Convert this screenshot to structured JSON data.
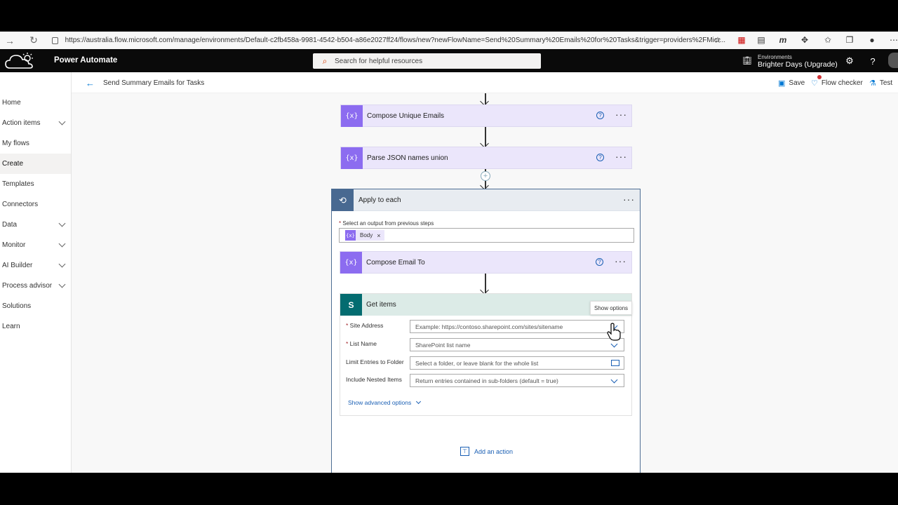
{
  "browser": {
    "url": "https://australia.flow.microsoft.com/manage/environments/Default-c2fb458a-9981-4542-b504-a86e2027ff24/flows/new?newFlowName=Send%20Summary%20Emails%20for%20Tasks&trigger=providers%2FMicr..."
  },
  "app": {
    "name": "Power Automate",
    "search_placeholder": "Search for helpful resources",
    "environment_label": "Environments",
    "environment_name": "Brighter Days (Upgrade)"
  },
  "nav": {
    "items": [
      {
        "label": "Home"
      },
      {
        "label": "Action items"
      },
      {
        "label": "My flows"
      },
      {
        "label": "Create"
      },
      {
        "label": "Templates"
      },
      {
        "label": "Connectors"
      },
      {
        "label": "Data"
      },
      {
        "label": "Monitor"
      },
      {
        "label": "AI Builder"
      },
      {
        "label": "Process advisor"
      },
      {
        "label": "Solutions"
      },
      {
        "label": "Learn"
      }
    ]
  },
  "toolbar": {
    "flow_title": "Send Summary Emails for Tasks",
    "save": "Save",
    "flow_checker": "Flow checker",
    "test": "Test"
  },
  "flow": {
    "compose_unique": "Compose Unique Emails",
    "parse_json": "Parse JSON names union",
    "apply_each": "Apply to each",
    "select_output_label": "Select an output from previous steps",
    "token_body": "Body",
    "compose_email_to": "Compose Email To",
    "get_items": "Get items",
    "show_options": "Show options",
    "site_address_label": "Site Address",
    "site_address_placeholder": "Example: https://contoso.sharepoint.com/sites/sitename",
    "list_name_label": "List Name",
    "list_name_placeholder": "SharePoint list name",
    "limit_folder_label": "Limit Entries to Folder",
    "limit_folder_placeholder": "Select a folder, or leave blank for the whole list",
    "nested_label": "Include Nested Items",
    "nested_value": "Return entries contained in sub-folders (default = true)",
    "show_advanced": "Show advanced options",
    "add_action": "Add an action"
  },
  "colors": {
    "compose_tile": "#8c6cf0",
    "compose_bg": "#ebe6fb",
    "sharepoint_tile": "#036c70",
    "apply_tile": "#486991",
    "link": "#1a5fb4"
  }
}
